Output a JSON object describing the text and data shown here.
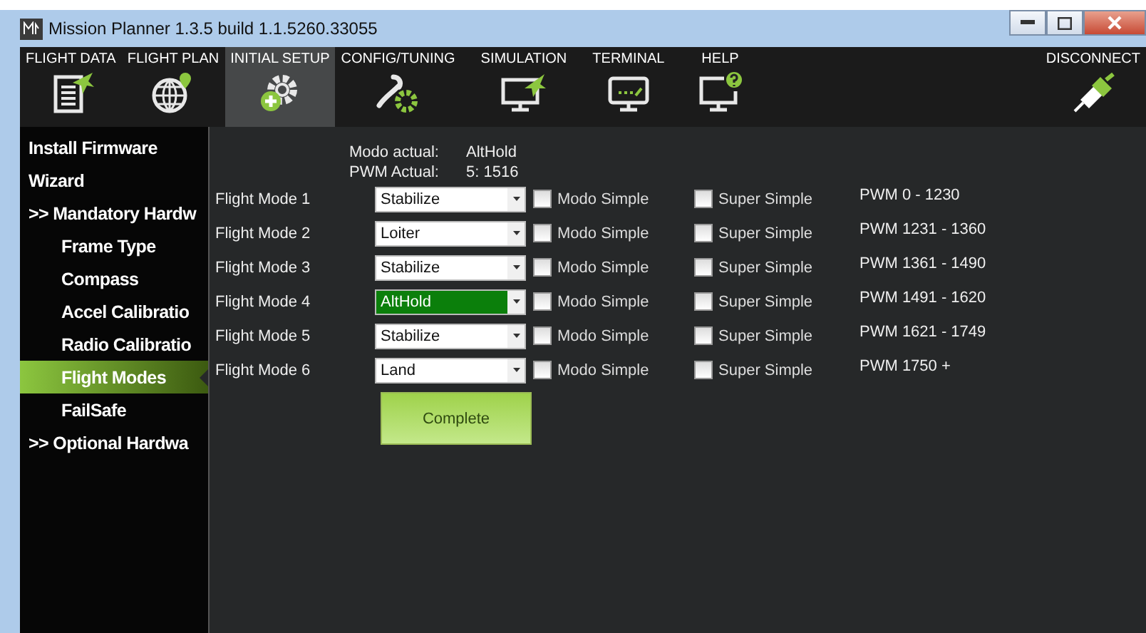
{
  "window": {
    "title": "Mission Planner 1.3.5 build 1.1.5260.33055"
  },
  "menu": [
    {
      "label": "FLIGHT DATA",
      "selected": false
    },
    {
      "label": "FLIGHT PLAN",
      "selected": false
    },
    {
      "label": "INITIAL SETUP",
      "selected": true
    },
    {
      "label": "CONFIG/TUNING",
      "selected": false
    },
    {
      "label": "SIMULATION",
      "selected": false
    },
    {
      "label": "TERMINAL",
      "selected": false
    },
    {
      "label": "HELP",
      "selected": false
    }
  ],
  "connect": {
    "label": "DISCONNECT"
  },
  "sidebar": {
    "items": [
      {
        "label": "Install Firmware",
        "selected": false
      },
      {
        "label": "Wizard",
        "selected": false
      },
      {
        "label": ">> Mandatory Hardw",
        "selected": false,
        "children": [
          {
            "label": "Frame Type",
            "selected": false
          },
          {
            "label": "Compass",
            "selected": false
          },
          {
            "label": "Accel Calibratio",
            "selected": false
          },
          {
            "label": "Radio Calibratio",
            "selected": false
          },
          {
            "label": "Flight Modes",
            "selected": true
          },
          {
            "label": "FailSafe",
            "selected": false
          }
        ]
      },
      {
        "label": ">> Optional Hardwa",
        "selected": false
      }
    ]
  },
  "status": [
    {
      "label": "Modo actual:",
      "value": "AltHold"
    },
    {
      "label": "PWM Actual:",
      "value": "5: 1516"
    }
  ],
  "modes": [
    {
      "label": "Flight Mode 1",
      "value": "Stabilize",
      "active": false,
      "simple": {
        "label": "Modo Simple",
        "checked": false
      },
      "super_simple": {
        "label": "Super Simple",
        "checked": false
      },
      "pwm": "PWM 0 - 1230"
    },
    {
      "label": "Flight Mode 2",
      "value": "Loiter",
      "active": false,
      "simple": {
        "label": "Modo Simple",
        "checked": false
      },
      "super_simple": {
        "label": "Super Simple",
        "checked": false
      },
      "pwm": "PWM 1231 - 1360"
    },
    {
      "label": "Flight Mode 3",
      "value": "Stabilize",
      "active": false,
      "simple": {
        "label": "Modo Simple",
        "checked": false
      },
      "super_simple": {
        "label": "Super Simple",
        "checked": false
      },
      "pwm": "PWM 1361 - 1490"
    },
    {
      "label": "Flight Mode 4",
      "value": "AltHold",
      "active": true,
      "simple": {
        "label": "Modo Simple",
        "checked": false
      },
      "super_simple": {
        "label": "Super Simple",
        "checked": false
      },
      "pwm": "PWM 1491 - 1620"
    },
    {
      "label": "Flight Mode 5",
      "value": "Stabilize",
      "active": false,
      "simple": {
        "label": "Modo Simple",
        "checked": false
      },
      "super_simple": {
        "label": "Super Simple",
        "checked": false
      },
      "pwm": "PWM 1621 - 1749"
    },
    {
      "label": "Flight Mode 6",
      "value": "Land",
      "active": false,
      "simple": {
        "label": "Modo Simple",
        "checked": false
      },
      "super_simple": {
        "label": "Super Simple",
        "checked": false
      },
      "pwm": "PWM 1750 +"
    }
  ],
  "complete_button": {
    "label": "Complete"
  }
}
